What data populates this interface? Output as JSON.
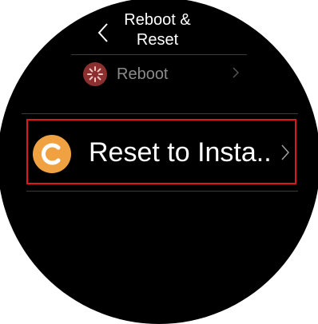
{
  "header": {
    "title": "Reboot &\nReset",
    "back_icon": "chevron-left-icon"
  },
  "menu": {
    "items": [
      {
        "label": "Reboot",
        "icon": "reboot-spinner-icon",
        "icon_color": "#8b2f2f",
        "chevron": "chevron-right-icon"
      },
      {
        "label": "Reset to Insta..",
        "icon": "reset-c-icon",
        "icon_color": "#f0a243",
        "chevron": "chevron-right-icon",
        "highlighted": true,
        "highlight_color": "#e0161b"
      }
    ]
  },
  "colors": {
    "background": "#000000",
    "text": "#ffffff",
    "muted_text": "#8a8a8a"
  }
}
